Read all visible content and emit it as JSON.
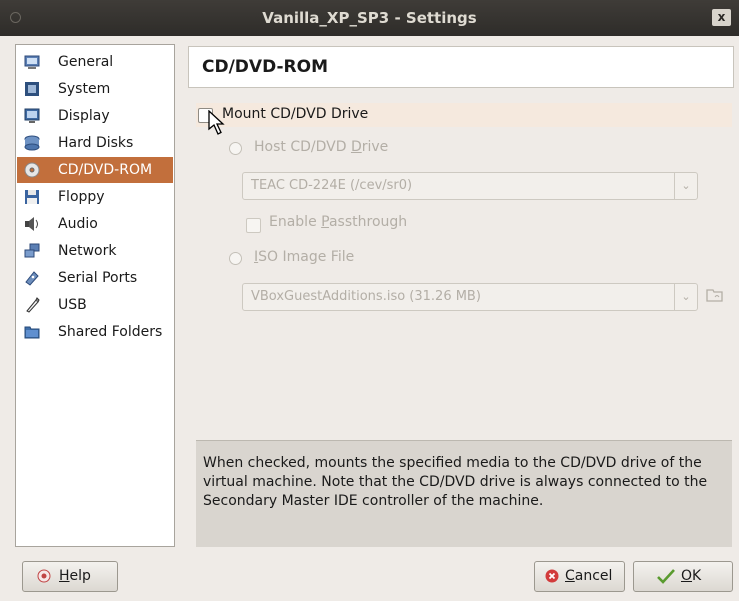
{
  "window": {
    "title": "Vanilla_XP_SP3 - Settings",
    "close_glyph": "x"
  },
  "sidebar": {
    "items": [
      {
        "label": "General",
        "icon": "general-icon"
      },
      {
        "label": "System",
        "icon": "system-icon"
      },
      {
        "label": "Display",
        "icon": "display-icon"
      },
      {
        "label": "Hard Disks",
        "icon": "hard-disks-icon"
      },
      {
        "label": "CD/DVD-ROM",
        "icon": "cd-dvd-icon",
        "selected": true
      },
      {
        "label": "Floppy",
        "icon": "floppy-icon"
      },
      {
        "label": "Audio",
        "icon": "audio-icon"
      },
      {
        "label": "Network",
        "icon": "network-icon"
      },
      {
        "label": "Serial Ports",
        "icon": "serial-ports-icon"
      },
      {
        "label": "USB",
        "icon": "usb-icon"
      },
      {
        "label": "Shared Folders",
        "icon": "shared-folders-icon"
      }
    ]
  },
  "page": {
    "title": "CD/DVD-ROM",
    "mount": {
      "label": "Mount CD/DVD Drive",
      "checked": false
    },
    "host_drive": {
      "label_pre": "Host CD/DVD ",
      "label_u": "D",
      "label_post": "rive",
      "value": "TEAC CD-224E (/cev/sr0)"
    },
    "passthrough": {
      "label_pre": "Enable ",
      "label_u": "P",
      "label_post": "assthrough"
    },
    "iso_image": {
      "label_u": "I",
      "label_post": "SO Image File",
      "value": "VBoxGuestAdditions.iso (31.26 MB)"
    },
    "description": "When checked, mounts the specified media to the CD/DVD drive of the virtual machine. Note that the CD/DVD drive is always connected to the Secondary Master IDE controller of the machine."
  },
  "buttons": {
    "help": {
      "u": "H",
      "rest": "elp"
    },
    "cancel": {
      "u": "C",
      "rest": "ancel"
    },
    "ok": {
      "u": "O",
      "rest": "K"
    }
  },
  "colors": {
    "selection": "#c26f3c",
    "titlebar": "#3a3734"
  }
}
